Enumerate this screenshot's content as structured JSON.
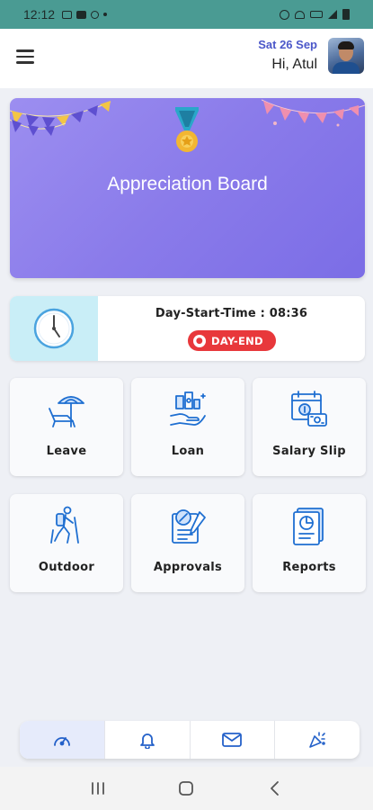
{
  "status_bar": {
    "time": "12:12",
    "left_icons": [
      "gallery-icon",
      "youtube-icon",
      "wrench-icon",
      "dot-icon"
    ],
    "right_icons": [
      "alarm-icon",
      "wifi-icon",
      "volte-icon",
      "signal-icon",
      "battery-icon"
    ]
  },
  "header": {
    "menu_icon": "hamburger-menu-icon",
    "date": "Sat 26 Sep",
    "greeting": "Hi, Atul",
    "avatar": "user-avatar"
  },
  "banner": {
    "title": "Appreciation Board",
    "icon": "medal-icon"
  },
  "attendance": {
    "day_start_text": "Day-Start-Time : 08:36",
    "day_end_label": "DAY-END",
    "clock_icon": "clock-icon"
  },
  "tiles": [
    {
      "label": "Leave",
      "icon": "beach-chair-icon"
    },
    {
      "label": "Loan",
      "icon": "money-hand-icon"
    },
    {
      "label": "Salary Slip",
      "icon": "salary-calendar-icon"
    },
    {
      "label": "Outdoor",
      "icon": "hiker-icon"
    },
    {
      "label": "Approvals",
      "icon": "approval-document-icon"
    },
    {
      "label": "Reports",
      "icon": "report-chart-icon"
    }
  ],
  "bottom_nav": [
    {
      "icon": "dashboard-gauge-icon",
      "active": true
    },
    {
      "icon": "bell-icon",
      "active": false
    },
    {
      "icon": "mail-icon",
      "active": false
    },
    {
      "icon": "party-popper-icon",
      "active": false
    }
  ],
  "system_nav": [
    "recent-apps-icon",
    "home-icon",
    "back-icon"
  ],
  "colors": {
    "status_bar": "#4a9b93",
    "accent_blue": "#4b57c9",
    "banner": "#8a7bea",
    "day_end": "#e8383b",
    "clock_panel": "#c9eef7",
    "icon_blue": "#1f6fd1"
  }
}
